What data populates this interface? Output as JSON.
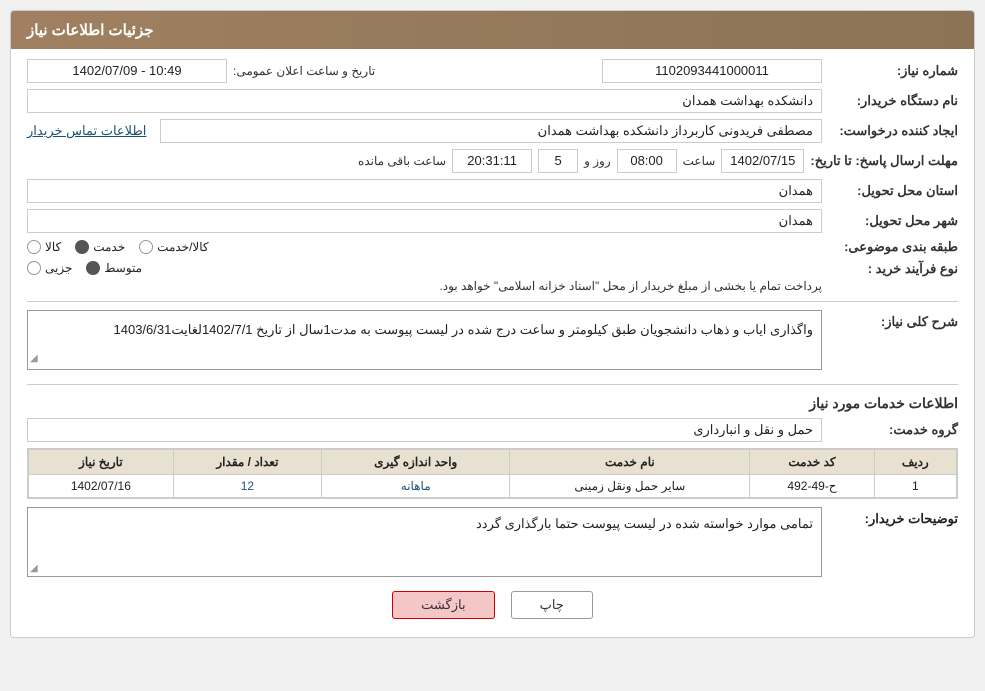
{
  "header": {
    "title": "جزئیات اطلاعات نیاز"
  },
  "fields": {
    "need_number_label": "شماره نیاز:",
    "need_number_value": "1102093441000011",
    "date_label": "تاریخ و ساعت اعلان عمومی:",
    "date_value": "1402/07/09 - 10:49",
    "buyer_org_label": "نام دستگاه خریدار:",
    "buyer_org_value": "دانشکده بهداشت همدان",
    "requester_label": "ایجاد کننده درخواست:",
    "requester_value": "مصطفی فریدونی کاربرداز دانشکده بهداشت همدان",
    "contact_link": "اطلاعات تماس خریدار",
    "deadline_label": "مهلت ارسال پاسخ: تا تاریخ:",
    "deadline_date": "1402/07/15",
    "deadline_time_label": "ساعت",
    "deadline_time": "08:00",
    "deadline_days_label": "روز و",
    "deadline_days": "5",
    "deadline_remaining_label": "ساعت باقی مانده",
    "deadline_remaining": "20:31:11",
    "province_label": "استان محل تحویل:",
    "province_value": "همدان",
    "city_label": "شهر محل تحویل:",
    "city_value": "همدان",
    "category_label": "طبقه بندی موضوعی:",
    "category_options": [
      {
        "label": "کالا",
        "selected": false
      },
      {
        "label": "خدمت",
        "selected": true
      },
      {
        "label": "کالا/خدمت",
        "selected": false
      }
    ],
    "purchase_type_label": "نوع فرآیند خرید :",
    "purchase_type_options": [
      {
        "label": "جزیی",
        "selected": false
      },
      {
        "label": "متوسط",
        "selected": true
      }
    ],
    "purchase_type_note": "پرداخت تمام یا بخشی از مبلغ خریدار از محل \"اسناد خزانه اسلامی\" خواهد بود.",
    "description_label": "شرح کلی نیاز:",
    "description_value": "واگذاری ایاب و ذهاب دانشجویان طبق کیلومتر و ساعت درج شده در لیست پیوست به مدت1سال از تاریخ 1402/7/1لغایت1403/6/31",
    "services_section": "اطلاعات خدمات مورد نیاز",
    "service_group_label": "گروه خدمت:",
    "service_group_value": "حمل و نقل و انبارداری",
    "table": {
      "headers": [
        "ردیف",
        "کد خدمت",
        "نام خدمت",
        "واحد اندازه گیری",
        "تعداد / مقدار",
        "تاریخ نیاز"
      ],
      "rows": [
        {
          "row": "1",
          "code": "ح-49-492",
          "name": "سایر حمل ونقل زمینی",
          "unit": "ماهانه",
          "quantity": "12",
          "date": "1402/07/16"
        }
      ]
    },
    "buyer_notes_label": "توضیحات خریدار:",
    "buyer_notes_value": "تمامی موارد خواسته شده در لیست پیوست حتما بارگذاری گردد"
  },
  "buttons": {
    "print_label": "چاپ",
    "back_label": "بازگشت"
  }
}
